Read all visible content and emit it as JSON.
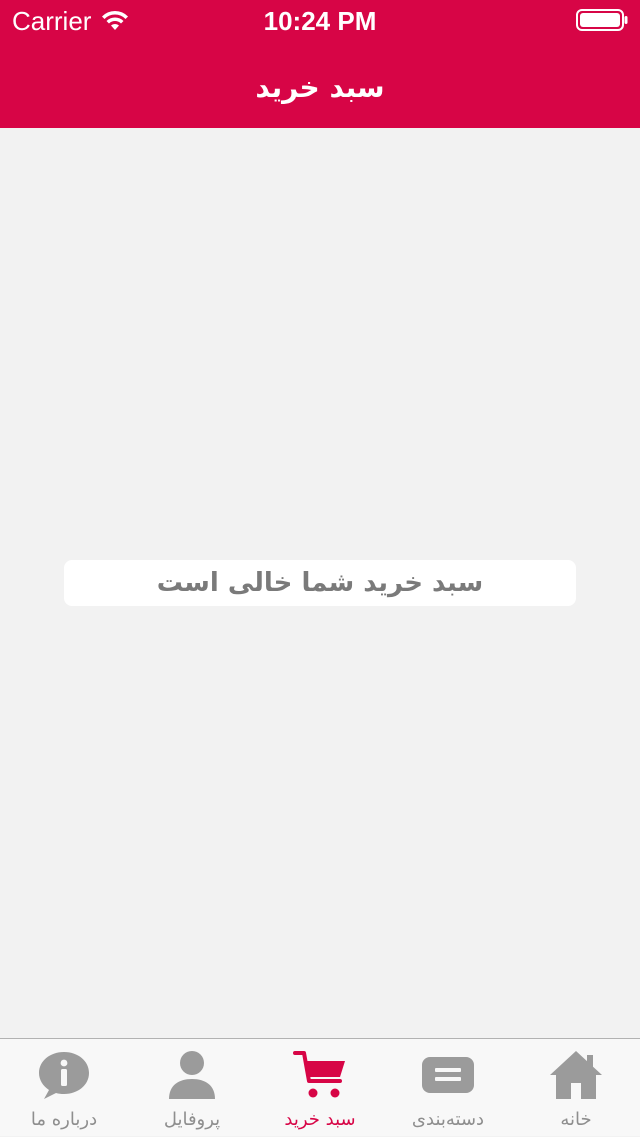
{
  "status_bar": {
    "carrier": "Carrier",
    "time": "10:24 PM"
  },
  "header": {
    "title": "سبد خرید"
  },
  "main": {
    "empty_message": "سبد خرید شما خالی است"
  },
  "tabbar": {
    "active_color": "#d70546",
    "inactive_color": "#8e8e8e",
    "tabs": [
      {
        "label": "درباره ما",
        "icon": "info-icon"
      },
      {
        "label": "پروفایل",
        "icon": "person-icon"
      },
      {
        "label": "سبد خرید",
        "icon": "cart-icon",
        "active": true
      },
      {
        "label": "دسته‌بندی",
        "icon": "category-icon"
      },
      {
        "label": "خانه",
        "icon": "home-icon"
      }
    ]
  },
  "colors": {
    "brand": "#d70546",
    "background": "#f2f2f2"
  }
}
